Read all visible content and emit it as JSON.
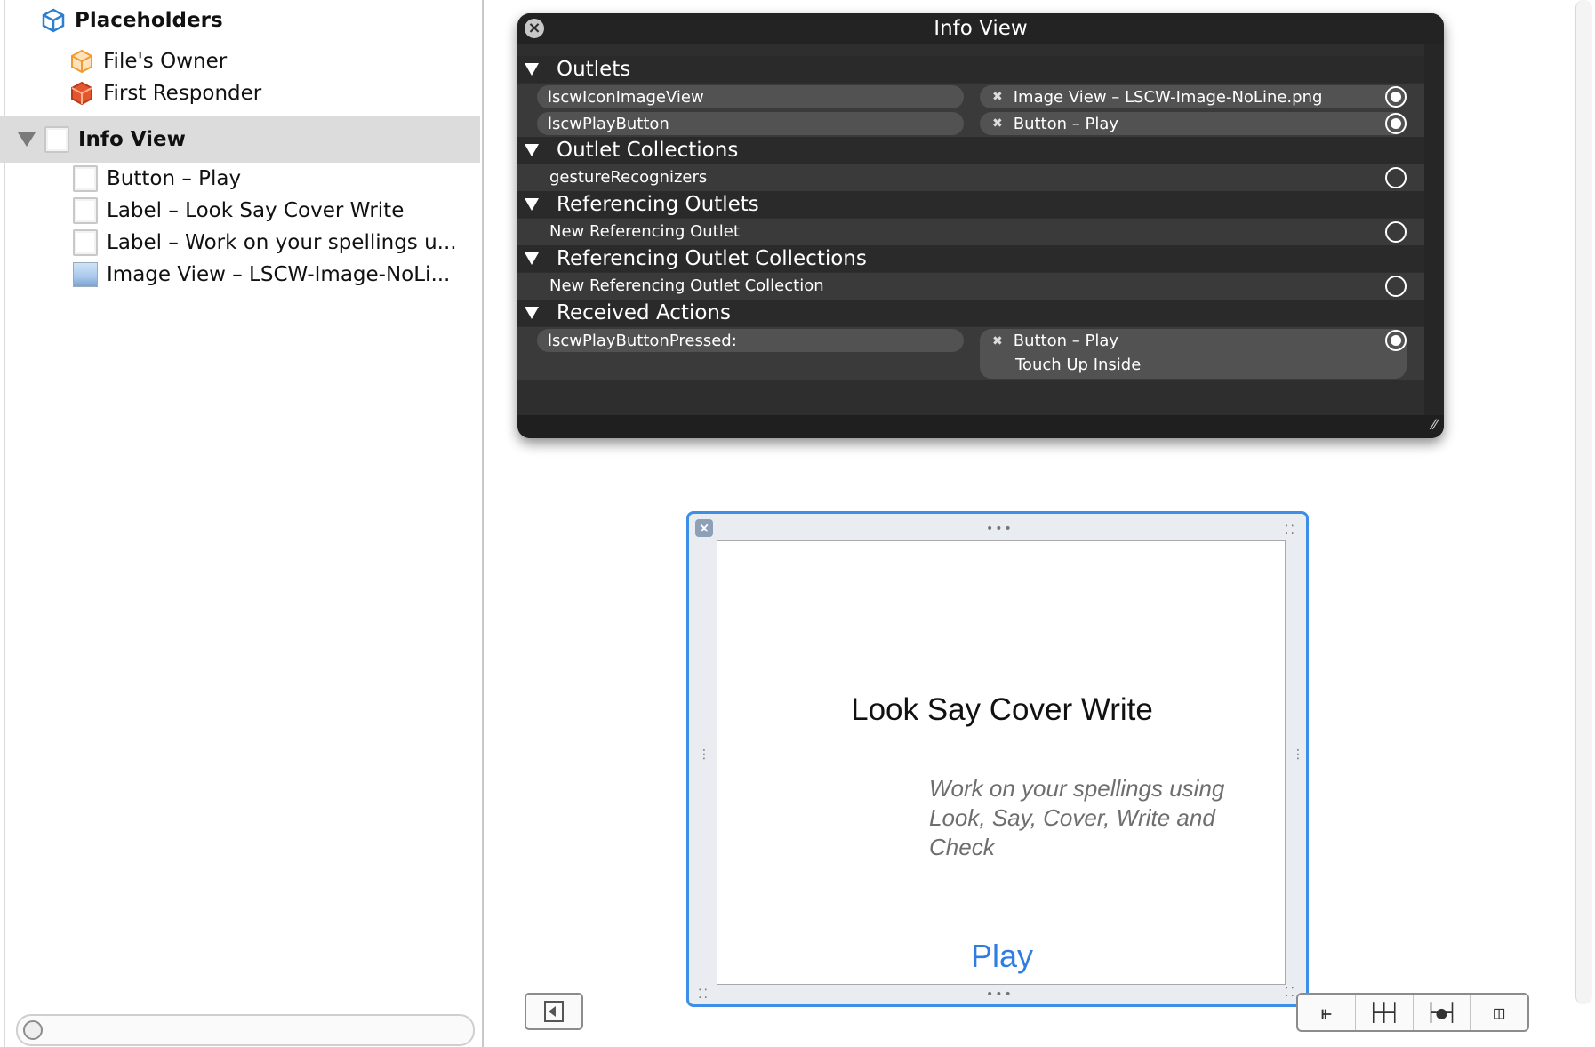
{
  "sidebar": {
    "placeholders_label": "Placeholders",
    "files_owner": "File's Owner",
    "first_responder": "First Responder",
    "info_view": "Info View",
    "children": [
      "Button – Play",
      "Label – Look Say Cover Write",
      "Label – Work on your spellings u...",
      "Image View – LSCW-Image-NoLi..."
    ]
  },
  "hud": {
    "title": "Info View",
    "sections": {
      "outlets": "Outlets",
      "outlet_collections": "Outlet Collections",
      "referencing_outlets": "Referencing Outlets",
      "referencing_outlet_collections": "Referencing Outlet Collections",
      "received_actions": "Received Actions"
    },
    "outlets": [
      {
        "name": "lscwIconImageView",
        "target": "Image View – LSCW-Image-NoLine.png"
      },
      {
        "name": "lscwPlayButton",
        "target": "Button – Play"
      }
    ],
    "gesture_recognizers": "gestureRecognizers",
    "new_referencing_outlet": "New Referencing Outlet",
    "new_referencing_outlet_collection": "New Referencing Outlet Collection",
    "action": {
      "name": "lscwPlayButtonPressed:",
      "target": "Button – Play",
      "event": "Touch Up Inside"
    }
  },
  "view": {
    "title": "Look Say Cover Write",
    "subtitle": "Work on your spellings using Look, Say, Cover, Write and Check",
    "play_button": "Play"
  },
  "colors": {
    "hud_background": "#2e2e2e",
    "selection_frame": "#3d8ee6",
    "play_link": "#2f7de1",
    "sidebar_selection": "#dcdcdc"
  },
  "icons": {
    "placeholders": "cube-outline-icon",
    "files_owner": "cube-orange-outline-icon",
    "first_responder": "cube-red-icon",
    "view": "view-icon",
    "image_view": "image-view-icon"
  }
}
